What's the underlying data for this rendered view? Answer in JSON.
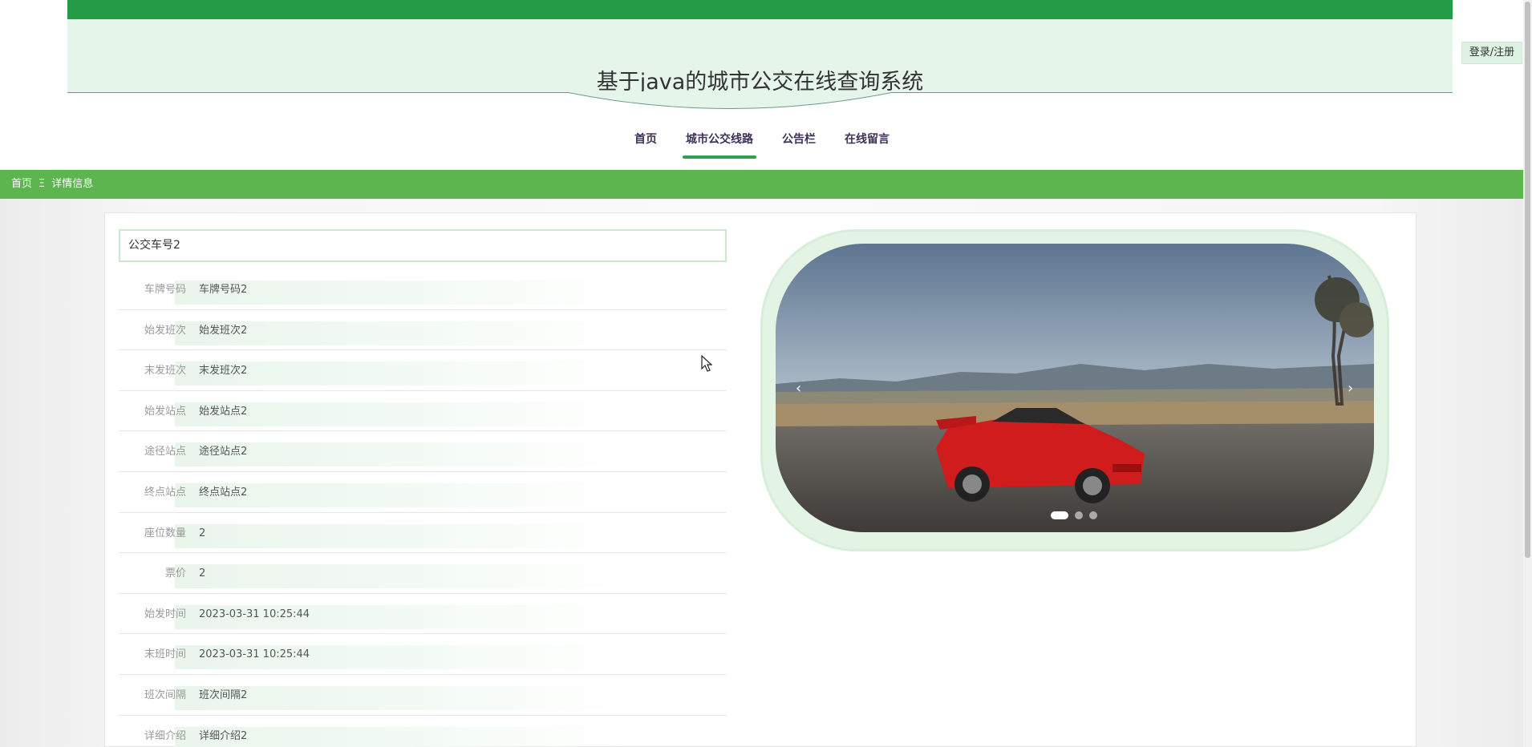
{
  "header": {
    "title": "基于java的城市公交在线查询系统",
    "login_label": "登录/注册"
  },
  "nav": {
    "items": [
      {
        "label": "首页",
        "active": false
      },
      {
        "label": "城市公交线路",
        "active": true
      },
      {
        "label": "公告栏",
        "active": false
      },
      {
        "label": "在线留言",
        "active": false
      }
    ]
  },
  "breadcrumb": {
    "home": "首页",
    "separator": "Ξ",
    "current": "详情信息"
  },
  "detail": {
    "title": "公交车号2",
    "fields": [
      {
        "label": "车牌号码",
        "value": "车牌号码2"
      },
      {
        "label": "始发班次",
        "value": "始发班次2"
      },
      {
        "label": "末发班次",
        "value": "末发班次2"
      },
      {
        "label": "始发站点",
        "value": "始发站点2"
      },
      {
        "label": "途径站点",
        "value": "途径站点2"
      },
      {
        "label": "终点站点",
        "value": "终点站点2"
      },
      {
        "label": "座位数量",
        "value": "2"
      },
      {
        "label": "票价",
        "value": "2"
      },
      {
        "label": "始发时间",
        "value": "2023-03-31 10:25:44"
      },
      {
        "label": "末班时间",
        "value": "2023-03-31 10:25:44"
      },
      {
        "label": "班次间隔",
        "value": "班次间隔2"
      },
      {
        "label": "详细介绍",
        "value": "详细介绍2"
      }
    ]
  },
  "carousel": {
    "prev_icon": "‹",
    "next_icon": "›",
    "slide_count": 3,
    "active_index": 0
  },
  "colors": {
    "top_bar": "#259b45",
    "header_bg": "#e6f5ea",
    "breadcrumb_bg": "#5cb54f",
    "nav_accent": "#2ea04f"
  }
}
